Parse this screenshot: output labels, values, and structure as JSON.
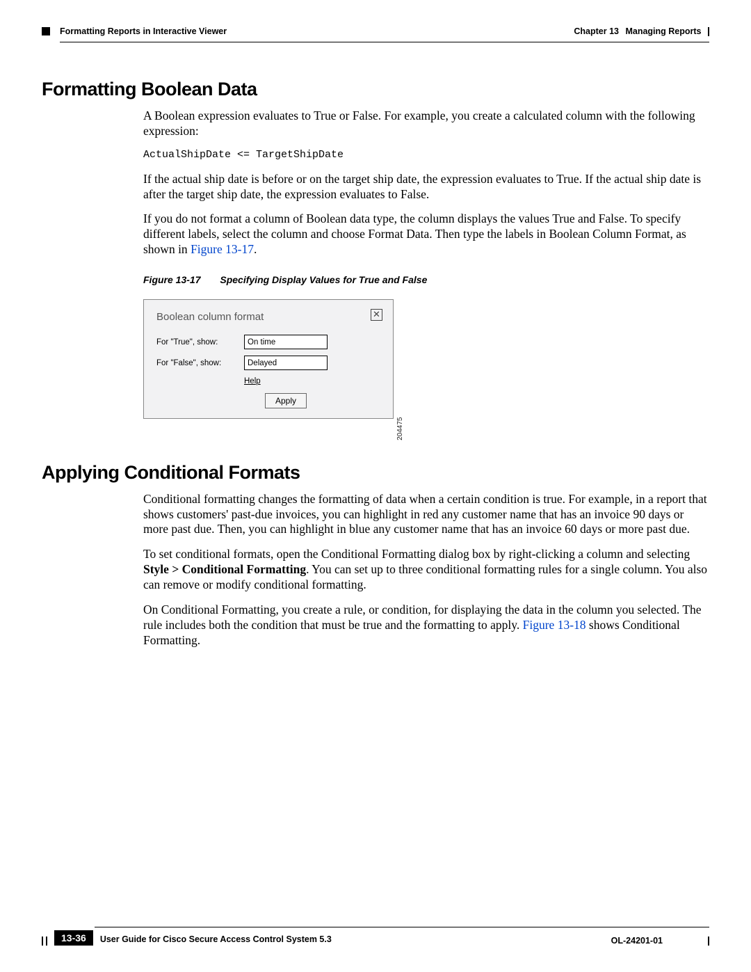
{
  "header": {
    "section": "Formatting Reports in Interactive Viewer",
    "chapter_label": "Chapter 13",
    "chapter_title": "Managing Reports"
  },
  "section1": {
    "heading": "Formatting Boolean Data",
    "p1": "A Boolean expression evaluates to True or False. For example, you create a calculated column with the following expression:",
    "code": "ActualShipDate <= TargetShipDate",
    "p2": "If the actual ship date is before or on the target ship date, the expression evaluates to True. If the actual ship date is after the target ship date, the expression evaluates to False.",
    "p3a": "If you do not format a column of Boolean data type, the column displays the values True and False. To specify different labels, select the column and choose Format Data. Then type the labels in Boolean Column Format, as shown in ",
    "p3link": "Figure 13-17",
    "p3b": "."
  },
  "figure": {
    "label": "Figure 13-17",
    "title": "Specifying Display Values for True and False",
    "dialog_title": "Boolean column format",
    "row_true_label": "For \"True\", show:",
    "row_true_value": "On time",
    "row_false_label": "For \"False\", show:",
    "row_false_value": "Delayed",
    "help": "Help",
    "apply": "Apply",
    "side_number": "204475"
  },
  "section2": {
    "heading": "Applying Conditional Formats",
    "p1": "Conditional formatting changes the formatting of data when a certain condition is true. For example, in a report that shows customers' past-due invoices, you can highlight in red any customer name that has an invoice 90 days or more past due. Then, you can highlight in blue any customer name that has an invoice 60 days or more past due.",
    "p2a": "To set conditional formats, open the Conditional Formatting dialog box by right-clicking a column and selecting ",
    "p2bold": "Style > Conditional Formatting",
    "p2b": ". You can set up to three conditional formatting rules for a single column. You also can remove or modify conditional formatting.",
    "p3a": "On Conditional Formatting, you create a rule, or condition, for displaying the data in the column you selected. The rule includes both the condition that must be true and the formatting to apply. ",
    "p3link": "Figure 13-18",
    "p3b": " shows Conditional Formatting."
  },
  "footer": {
    "guide": "User Guide for Cisco Secure Access Control System 5.3",
    "page": "13-36",
    "docid": "OL-24201-01"
  }
}
